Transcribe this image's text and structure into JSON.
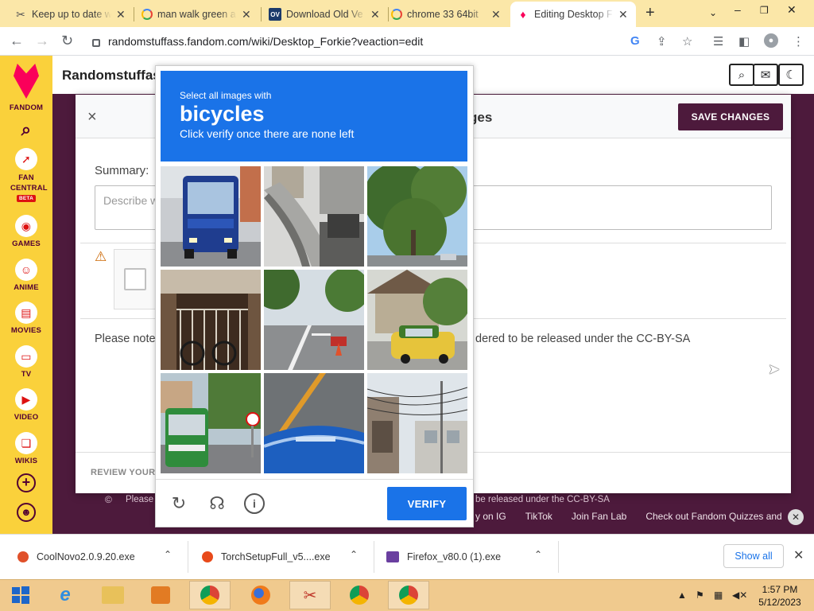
{
  "browser": {
    "tabs": [
      {
        "title": "Keep up to date wi",
        "favicon": "keep-icon"
      },
      {
        "title": "man walk green a",
        "favicon": "google-icon"
      },
      {
        "title": "Download Old Ve",
        "favicon": "ov-icon",
        "favicon_text": "OV"
      },
      {
        "title": "chrome 33 64bit",
        "favicon": "google-icon"
      },
      {
        "title": "Editing Desktop F",
        "favicon": "fandom-icon",
        "active": true
      }
    ],
    "new_tab": "+",
    "url": "randomstuffass.fandom.com/wiki/Desktop_Forkie?veaction=edit"
  },
  "fandom": {
    "rail": [
      {
        "label": "FANDOM"
      },
      {
        "label": "FAN CENTRAL",
        "badge": "BETA"
      },
      {
        "label": "GAMES"
      },
      {
        "label": "ANIME"
      },
      {
        "label": "MOVIES"
      },
      {
        "label": "TV"
      },
      {
        "label": "VIDEO"
      },
      {
        "label": "WIKIS"
      }
    ],
    "site_name": "Randomstuffas",
    "header_icons": [
      "search-icon",
      "chat-icon",
      "moon-icon"
    ]
  },
  "editor": {
    "close": "×",
    "title_fragment": "ges",
    "save_label": "SAVE CHANGES",
    "summary_label": "Summary:",
    "summary_placeholder": "Describe w",
    "license_left": "Please note",
    "license_right": "dered to be released under the CC-BY-SA",
    "review_label": "REVIEW YOUR"
  },
  "page_footer": {
    "license_left": "Please",
    "license_right": "be released under the CC-BY-SA",
    "links": [
      "y on IG",
      "TikTok",
      "Join Fan Lab",
      "Check out Fandom Quizzes and cha"
    ]
  },
  "captcha": {
    "instruction_line1": "Select all images with",
    "target": "bicycles",
    "instruction_line2": "Click verify once there are none left",
    "tiles": [
      {
        "subject": "blue bus"
      },
      {
        "subject": "overpass"
      },
      {
        "subject": "trees"
      },
      {
        "subject": "bicycles by railing"
      },
      {
        "subject": "street with cones"
      },
      {
        "subject": "taxi"
      },
      {
        "subject": "green bus"
      },
      {
        "subject": "car hood"
      },
      {
        "subject": "houses with wires"
      }
    ],
    "controls": [
      "reload-icon",
      "audio-icon",
      "info-icon"
    ],
    "verify_label": "VERIFY"
  },
  "downloads": {
    "items": [
      {
        "name": "CoolNovo2.0.9.20.exe"
      },
      {
        "name": "TorchSetupFull_v5....exe"
      },
      {
        "name": "Firefox_v80.0 (1).exe"
      }
    ],
    "show_all": "Show all"
  },
  "taskbar": {
    "time": "1:57 PM",
    "date": "5/12/2023"
  }
}
